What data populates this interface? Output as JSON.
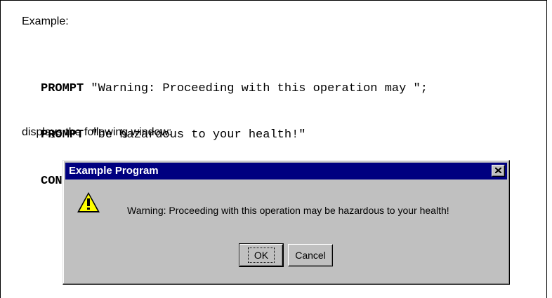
{
  "document": {
    "example_label": "Example:",
    "code_lines": [
      {
        "keyword": "PROMPT",
        "rest": " \"Warning: Proceeding with this operation may \";"
      },
      {
        "keyword": "PROMPT",
        "rest": " \"be hazardous to your health!\""
      },
      {
        "keyword": "CONFIRM",
        "rest": ""
      }
    ],
    "description": "displays the following window:"
  },
  "dialog": {
    "title": "Example Program",
    "icon": "warning-icon",
    "message": "Warning: Proceeding with this operation may be hazardous to your health!",
    "buttons": {
      "ok_label": "OK",
      "cancel_label": "Cancel"
    },
    "colors": {
      "titlebar": "#000080",
      "face": "#c0c0c0",
      "warning_fill": "#ffff00"
    }
  }
}
